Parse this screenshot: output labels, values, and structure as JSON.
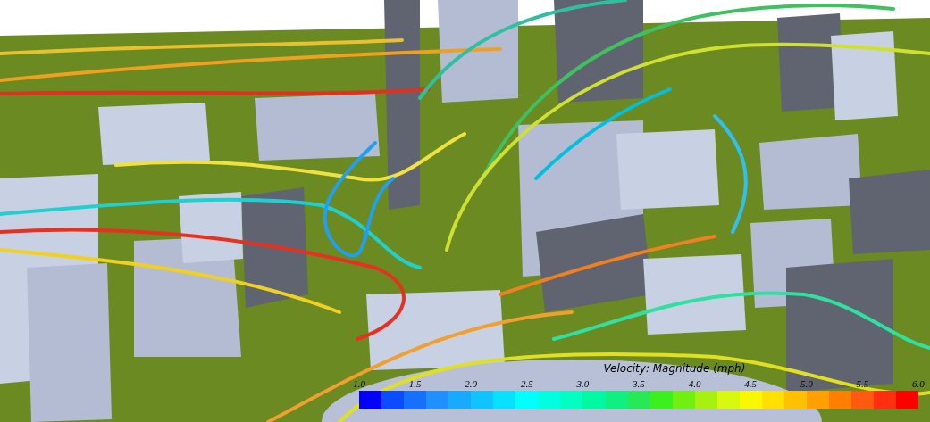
{
  "legend": {
    "title": "Velocity: Magnitude (mph)",
    "ticks": [
      "1.0",
      "1.5",
      "2.0",
      "2.5",
      "3.0",
      "3.5",
      "4.0",
      "4.5",
      "5.0",
      "5.5",
      "6.0"
    ]
  }
}
